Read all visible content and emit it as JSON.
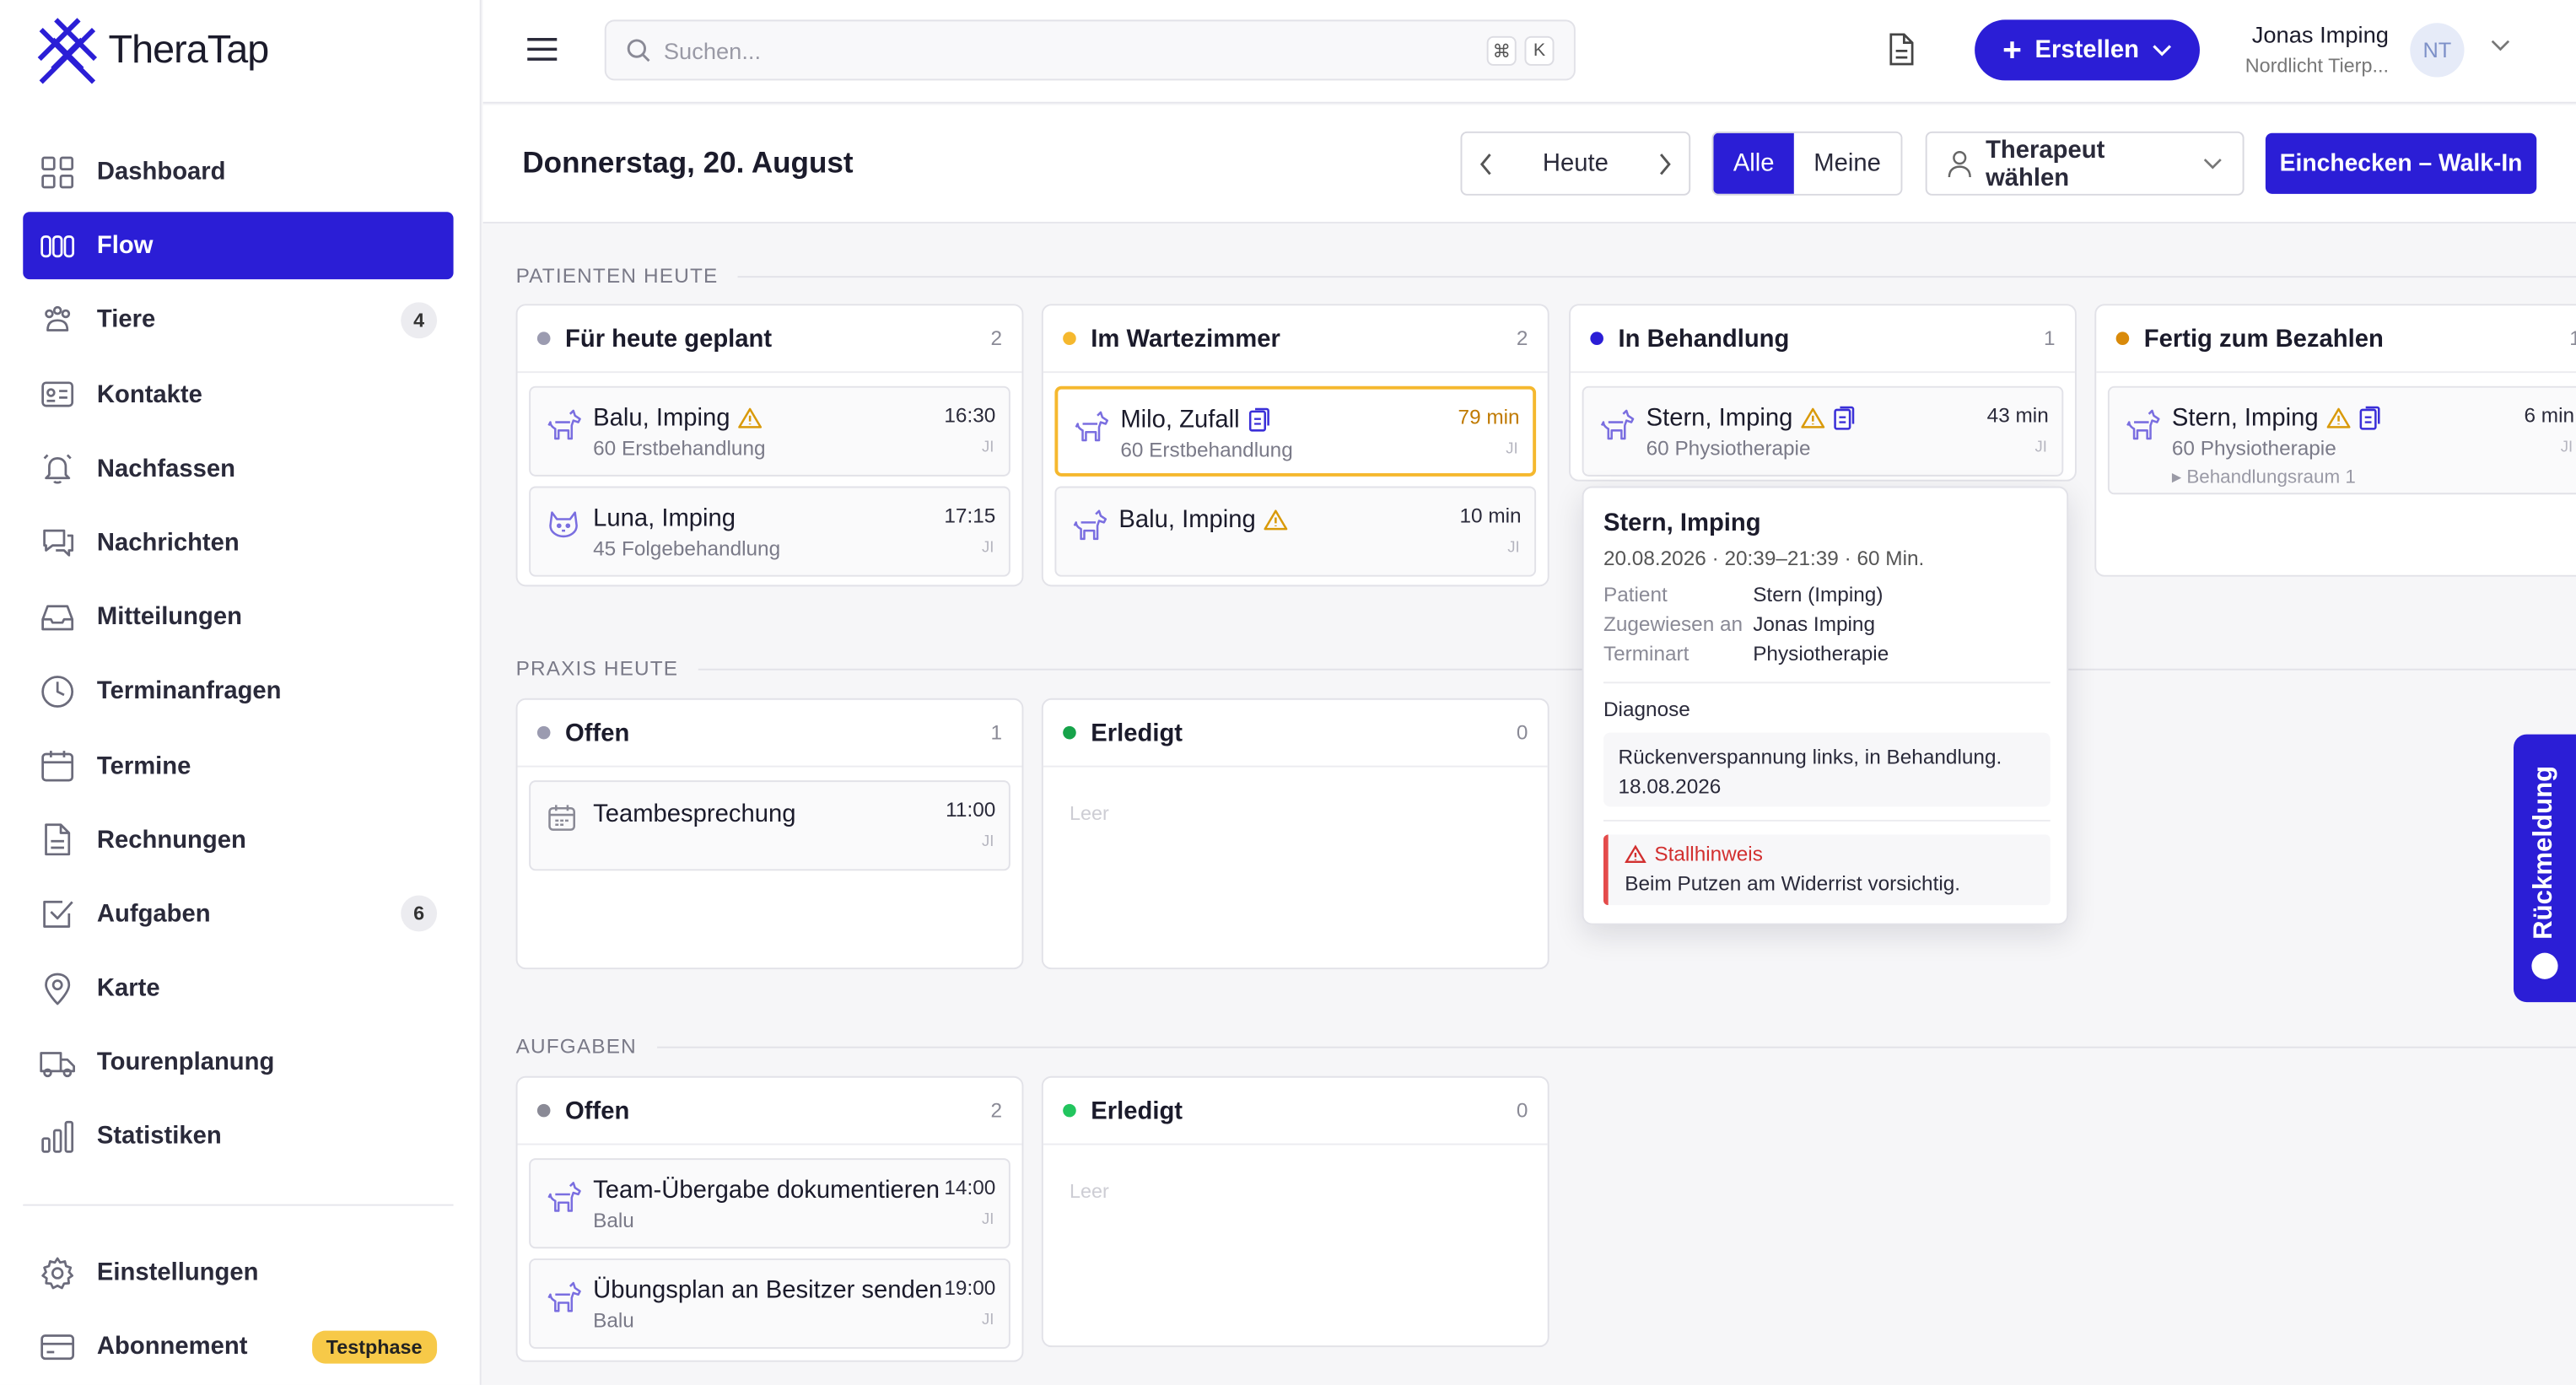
{
  "brand": {
    "name": "TheraTap",
    "accent": "#2b1ed6"
  },
  "sidebar": {
    "items": [
      {
        "label": "Dashboard",
        "icon": "grid-icon"
      },
      {
        "label": "Flow",
        "icon": "columns-icon",
        "active": true
      },
      {
        "label": "Tiere",
        "icon": "paw-icon",
        "badge": "4"
      },
      {
        "label": "Kontakte",
        "icon": "contact-card-icon"
      },
      {
        "label": "Nachfassen",
        "icon": "bell-icon"
      },
      {
        "label": "Nachrichten",
        "icon": "chat-icon"
      },
      {
        "label": "Mitteilungen",
        "icon": "inbox-icon"
      },
      {
        "label": "Terminanfragen",
        "icon": "clock-icon"
      },
      {
        "label": "Termine",
        "icon": "calendar-icon"
      },
      {
        "label": "Rechnungen",
        "icon": "document-icon"
      },
      {
        "label": "Aufgaben",
        "icon": "checkbox-icon",
        "badge": "6"
      },
      {
        "label": "Karte",
        "icon": "map-pin-icon"
      },
      {
        "label": "Tourenplanung",
        "icon": "truck-icon"
      },
      {
        "label": "Statistiken",
        "icon": "bar-chart-icon"
      }
    ],
    "bottom": [
      {
        "label": "Einstellungen",
        "icon": "gear-icon"
      },
      {
        "label": "Abonnement",
        "icon": "credit-card-icon",
        "badge": "Testphase"
      }
    ]
  },
  "topbar": {
    "search_placeholder": "Suchen...",
    "shortcut_mod": "⌘",
    "shortcut_key": "K",
    "create_label": "Erstellen",
    "user_name": "Jonas Imping",
    "user_org": "Nordlicht Tierp...",
    "avatar_initials": "NT"
  },
  "header": {
    "title": "Donnerstag, 20. August",
    "today_label": "Heute",
    "filter_all": "Alle",
    "filter_mine": "Meine",
    "therapist_label": "Therapeut wählen",
    "walkin_label": "Einchecken – Walk-In"
  },
  "sections": {
    "patients": {
      "label": "PATIENTEN HEUTE",
      "columns": [
        {
          "title": "Für heute geplant",
          "count": "2",
          "dot": "#9b9bb0",
          "cards": [
            {
              "name": "Balu, Imping",
              "sub": "60 Erstbehandlung",
              "time": "16:30",
              "initials": "JI",
              "icon": "horse-icon",
              "warn": true
            },
            {
              "name": "Luna, Imping",
              "sub": "45 Folgebehandlung",
              "time": "17:15",
              "initials": "JI",
              "icon": "cat-icon"
            }
          ]
        },
        {
          "title": "Im Wartezimmer",
          "count": "2",
          "dot": "#f5b82e",
          "cards": [
            {
              "name": "Milo, Zufall",
              "sub": "60 Erstbehandlung",
              "time": "79 min",
              "initials": "JI",
              "icon": "horse-icon",
              "clip": true,
              "highlight": true
            },
            {
              "name": "Balu, Imping",
              "sub": "",
              "time": "10 min",
              "initials": "JI",
              "icon": "horse-icon",
              "warn": true
            }
          ]
        },
        {
          "title": "In Behandlung",
          "count": "1",
          "dot": "#2b1ed6",
          "cards": [
            {
              "name": "Stern, Imping",
              "sub": "60 Physiotherapie",
              "time": "43 min",
              "initials": "JI",
              "icon": "horse-icon",
              "warn": true,
              "clip": true
            }
          ]
        },
        {
          "title": "Fertig zum Bezahlen",
          "count": "1",
          "dot": "#d98a0a",
          "cards": [
            {
              "name": "Stern, Imping",
              "sub": "60 Physiotherapie",
              "sub2": "▸ Behandlungsraum 1",
              "time": "6 min",
              "initials": "JI",
              "icon": "horse-icon",
              "warn": true,
              "clip": true
            }
          ]
        }
      ]
    },
    "practice": {
      "label": "PRAXIS HEUTE",
      "columns": [
        {
          "title": "Offen",
          "count": "1",
          "dot": "#9b9bb0",
          "cards": [
            {
              "name": "Teambesprechung",
              "time": "11:00",
              "initials": "JI",
              "icon": "calendar-icon"
            }
          ]
        },
        {
          "title": "Erledigt",
          "count": "0",
          "dot": "#16a34a",
          "empty": "Leer",
          "cards": []
        }
      ]
    },
    "tasks": {
      "label": "AUFGABEN",
      "columns": [
        {
          "title": "Offen",
          "count": "2",
          "dot": "#8a8a96",
          "cards": [
            {
              "name": "Team-Übergabe dokumentieren",
              "sub": "Balu",
              "time": "14:00",
              "initials": "JI",
              "icon": "horse-icon"
            },
            {
              "name": "Übungsplan an Besitzer senden",
              "sub": "Balu",
              "time": "19:00",
              "initials": "JI",
              "icon": "horse-icon"
            }
          ]
        },
        {
          "title": "Erledigt",
          "count": "0",
          "dot": "#22c55e",
          "empty": "Leer",
          "cards": []
        }
      ]
    }
  },
  "popover": {
    "title": "Stern, Imping",
    "meta": "20.08.2026 · 20:39–21:39 · 60 Min.",
    "rows": [
      {
        "k": "Patient",
        "v": "Stern (Imping)"
      },
      {
        "k": "Zugewiesen an",
        "v": "Jonas Imping"
      },
      {
        "k": "Terminart",
        "v": "Physiotherapie"
      }
    ],
    "diagnosis_label": "Diagnose",
    "diagnosis": "Rückenverspannung links, in Behandlung. 18.08.2026",
    "warning_title": "Stallhinweis",
    "warning_text": "Beim Putzen am Widerrist vorsichtig."
  },
  "feedback": {
    "label": "Rückmeldung"
  }
}
